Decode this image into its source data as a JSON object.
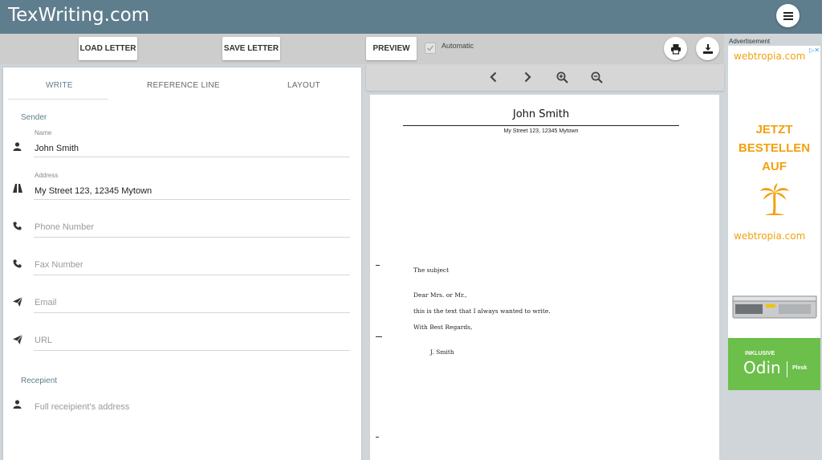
{
  "app": {
    "title": "TexWriting.com"
  },
  "toolbar": {
    "load_label": "LOAD LETTER",
    "save_label": "SAVE LETTER",
    "preview_label": "PREVIEW",
    "automatic_label": "Automatic",
    "automatic_checked": true
  },
  "tabs": [
    {
      "label": "WRITE",
      "active": true
    },
    {
      "label": "REFERENCE LINE",
      "active": false
    },
    {
      "label": "LAYOUT",
      "active": false
    }
  ],
  "sender": {
    "section_title": "Sender",
    "name": {
      "label": "Name",
      "value": "John Smith",
      "icon": "person-icon"
    },
    "address": {
      "label": "Address",
      "value": "My Street 123, 12345 Mytown",
      "icon": "road-icon"
    },
    "phone": {
      "placeholder": "Phone Number",
      "icon": "phone-icon"
    },
    "fax": {
      "placeholder": "Fax Number",
      "icon": "phone-icon"
    },
    "email": {
      "placeholder": "Email",
      "icon": "paper-plane-icon"
    },
    "url": {
      "placeholder": "URL",
      "icon": "paper-plane-icon"
    }
  },
  "recipient": {
    "section_title": "Recepient",
    "address": {
      "placeholder": "Full receipient's address",
      "icon": "person-icon"
    }
  },
  "preview": {
    "name": "John Smith",
    "address": "My Street 123, 12345 Mytown",
    "subject": "The subject",
    "greeting": "Dear Mrs. or Mr.,",
    "body": "this is the text that I always wanted to write.",
    "closing": "With Best Regards,",
    "signature": "J. Smith"
  },
  "ad": {
    "label": "Advertisement",
    "brand": "webtropia.com",
    "promo_lines": [
      "JETZT",
      "BESTELLEN",
      "AUF"
    ],
    "inklusive": "INKLUSIVE",
    "odin": "Odin",
    "plesk": "Plesk",
    "colors": {
      "orange": "#f2a10e",
      "green": "#6cbf4a"
    }
  },
  "colors": {
    "header": "#5f7e8d",
    "accent": "#5f7e8d"
  }
}
